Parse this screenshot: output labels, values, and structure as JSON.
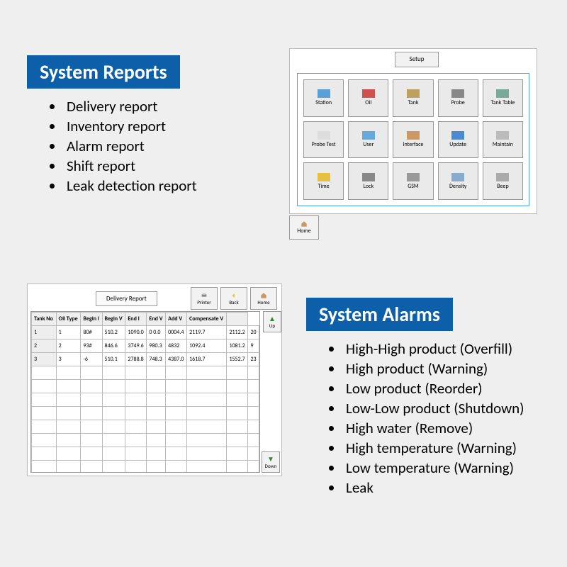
{
  "reports": {
    "heading": "System Reports",
    "items": [
      "Delivery report",
      "Inventory report",
      "Alarm report",
      "Shift report",
      "Leak detection report"
    ]
  },
  "alarms": {
    "heading": "System Alarms",
    "items": [
      "High-High product (Overfill)",
      "High product (Warning)",
      "Low product (Reorder)",
      "Low-Low product (Shutdown)",
      "High water (Remove)",
      "High temperature (Warning)",
      "Low temperature (Warning)",
      "Leak"
    ]
  },
  "setup_panel": {
    "title": "Setup",
    "home": "Home",
    "buttons": [
      "Station",
      "Oil",
      "Tank",
      "Probe",
      "Tank Table",
      "Probe Test",
      "User",
      "Interface",
      "Update",
      "Maintain",
      "Time",
      "Lock",
      "GSM",
      "Density",
      "Beep"
    ]
  },
  "report_panel": {
    "title": "Delivery Report",
    "tools": {
      "printer": "Printer",
      "back": "Back",
      "home": "Home"
    },
    "up": "Up",
    "down": "Down",
    "columns": [
      "Tank No",
      "Oil Type",
      "Begin l",
      "Begin V",
      "End l",
      "End V",
      "Add V",
      "Compensate V",
      ""
    ],
    "rows": [
      [
        "1",
        "80#",
        "510.2",
        "1090.0",
        "0 0.0",
        "0004.4",
        "2119.7",
        "2112.2",
        "20"
      ],
      [
        "2",
        "93#",
        "846.6",
        "3749.6",
        "980.3",
        "4832",
        "1092.4",
        "1081.2",
        "9"
      ],
      [
        "3",
        "-6",
        "510.1",
        "2788.8",
        "748.3",
        "4387.0",
        "1618.7",
        "1552.7",
        "23"
      ]
    ]
  }
}
